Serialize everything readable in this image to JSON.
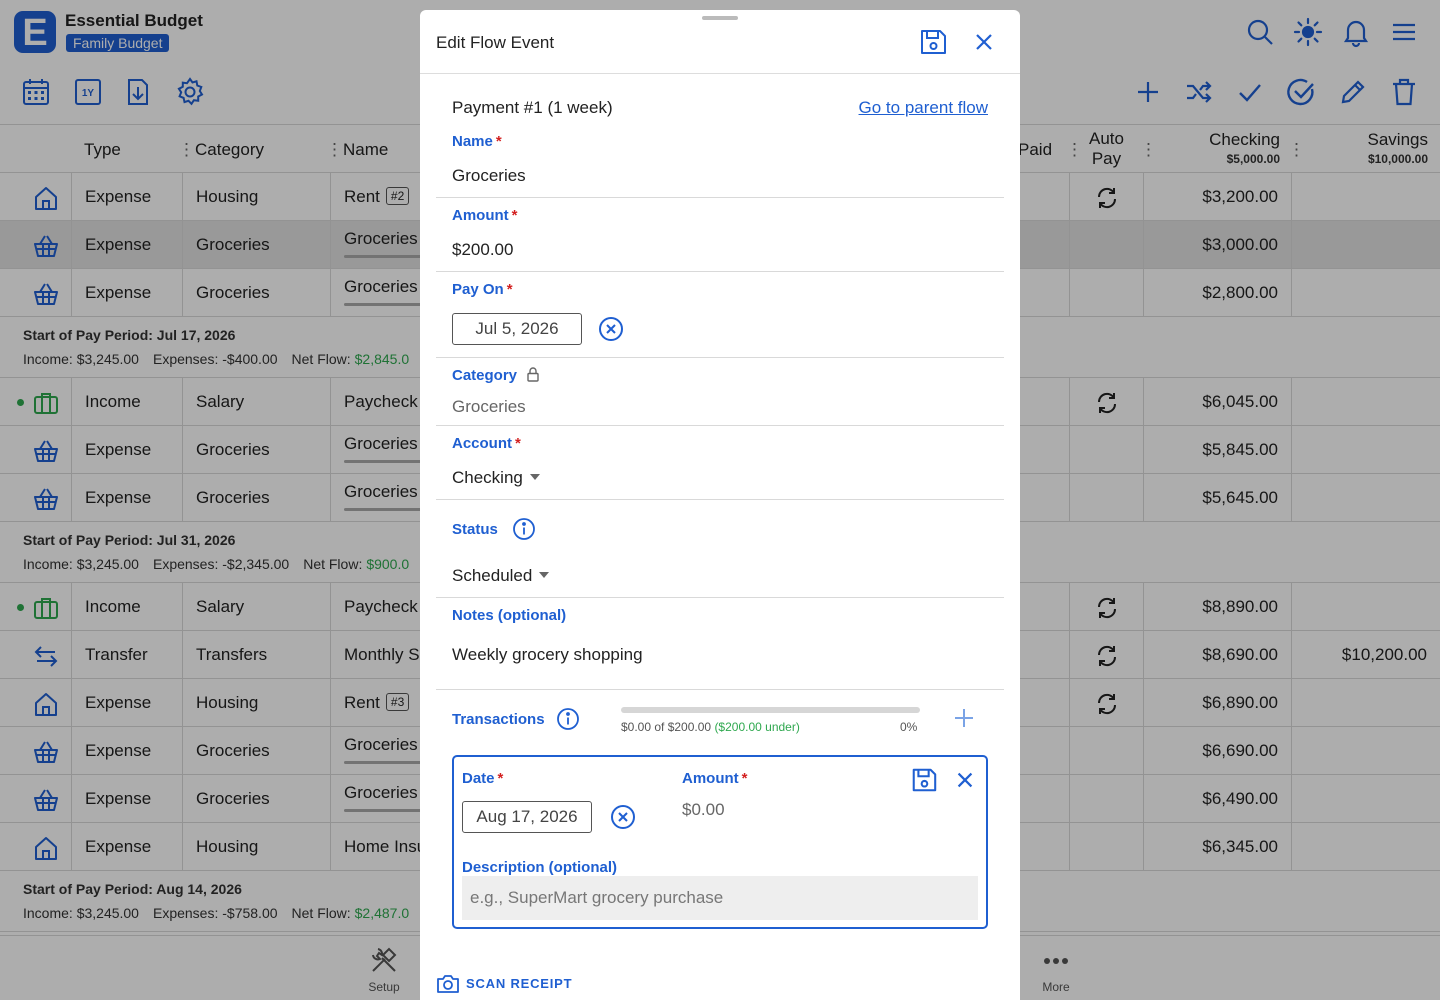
{
  "app": {
    "title": "Essential Budget",
    "badge": "Family Budget",
    "logo_letter": "E"
  },
  "toolbar_left": [
    "calendar-icon",
    "one-year-icon",
    "import-icon",
    "settings-icon"
  ],
  "toolbar_right": [
    "add-icon",
    "shuffle-icon",
    "check-icon",
    "check-circle-icon",
    "edit-icon",
    "delete-icon"
  ],
  "header_icons": [
    "search-icon",
    "theme-icon",
    "bell-icon",
    "menu-icon"
  ],
  "columns": {
    "type": "Type",
    "category": "Category",
    "name": "Name",
    "paid": "Paid",
    "autopay": "Auto",
    "autopay2": "Pay",
    "checking": "Checking",
    "checking_bal": "$5,000.00",
    "savings": "Savings",
    "savings_bal": "$10,000.00"
  },
  "rows": [
    {
      "icon": "house-icon",
      "type": "Expense",
      "category": "Housing",
      "name": "Rent",
      "tag": "#2",
      "autopay": true,
      "checking": "$3,200.00",
      "savings": "",
      "selected": false,
      "income": false,
      "underline": false
    },
    {
      "icon": "basket-icon",
      "type": "Expense",
      "category": "Groceries",
      "name": "Groceries",
      "tag": "",
      "autopay": false,
      "checking": "$3,000.00",
      "savings": "",
      "selected": true,
      "income": false,
      "underline": true
    },
    {
      "icon": "basket-icon",
      "type": "Expense",
      "category": "Groceries",
      "name": "Groceries",
      "tag": "",
      "autopay": false,
      "checking": "$2,800.00",
      "savings": "",
      "selected": false,
      "income": false,
      "underline": true
    },
    {
      "icon": "briefcase-icon",
      "type": "Income",
      "category": "Salary",
      "name": "Paycheck",
      "tag": "",
      "autopay": true,
      "checking": "$6,045.00",
      "savings": "",
      "selected": false,
      "income": true,
      "underline": false
    },
    {
      "icon": "basket-icon",
      "type": "Expense",
      "category": "Groceries",
      "name": "Groceries",
      "tag": "",
      "autopay": false,
      "checking": "$5,845.00",
      "savings": "",
      "selected": false,
      "income": false,
      "underline": true
    },
    {
      "icon": "basket-icon",
      "type": "Expense",
      "category": "Groceries",
      "name": "Groceries",
      "tag": "",
      "autopay": false,
      "checking": "$5,645.00",
      "savings": "",
      "selected": false,
      "income": false,
      "underline": true
    },
    {
      "icon": "briefcase-icon",
      "type": "Income",
      "category": "Salary",
      "name": "Paycheck",
      "tag": "",
      "autopay": true,
      "checking": "$8,890.00",
      "savings": "",
      "selected": false,
      "income": true,
      "underline": false
    },
    {
      "icon": "transfer-icon",
      "type": "Transfer",
      "category": "Transfers",
      "name": "Monthly Sa",
      "tag": "",
      "autopay": true,
      "checking": "$8,690.00",
      "savings": "$10,200.00",
      "selected": false,
      "income": false,
      "underline": false
    },
    {
      "icon": "house-icon",
      "type": "Expense",
      "category": "Housing",
      "name": "Rent",
      "tag": "#3",
      "autopay": true,
      "checking": "$6,890.00",
      "savings": "",
      "selected": false,
      "income": false,
      "underline": false
    },
    {
      "icon": "basket-icon",
      "type": "Expense",
      "category": "Groceries",
      "name": "Groceries",
      "tag": "",
      "autopay": false,
      "checking": "$6,690.00",
      "savings": "",
      "selected": false,
      "income": false,
      "underline": true
    },
    {
      "icon": "basket-icon",
      "type": "Expense",
      "category": "Groceries",
      "name": "Groceries",
      "tag": "",
      "autopay": false,
      "checking": "$6,490.00",
      "savings": "",
      "selected": false,
      "income": false,
      "underline": true
    },
    {
      "icon": "house-icon",
      "type": "Expense",
      "category": "Housing",
      "name": "Home Insu",
      "tag": "",
      "autopay": false,
      "checking": "$6,345.00",
      "savings": "",
      "selected": false,
      "income": false,
      "underline": false
    }
  ],
  "periods": [
    {
      "title": "Start of Pay Period: Jul 17, 2026",
      "income": "Income: $3,245.00",
      "expenses": "Expenses: -$400.00",
      "net_label": "Net Flow:",
      "net": "$2,845.0"
    },
    {
      "title": "Start of Pay Period: Jul 31, 2026",
      "income": "Income: $3,245.00",
      "expenses": "Expenses: -$2,345.00",
      "net_label": "Net Flow:",
      "net": "$900.0"
    },
    {
      "title": "Start of Pay Period: Aug 14, 2026",
      "income": "Income: $3,245.00",
      "expenses": "Expenses: -$758.00",
      "net_label": "Net Flow:",
      "net": "$2,487.0"
    }
  ],
  "bottom_nav": {
    "setup": "Setup",
    "more": "More"
  },
  "modal": {
    "title": "Edit Flow Event",
    "payment_label": "Payment #1 (1 week)",
    "parent_link": "Go to parent flow",
    "name_label": "Name",
    "name_value": "Groceries",
    "amount_label": "Amount",
    "amount_value": "$200.00",
    "payon_label": "Pay On",
    "payon_value": "Jul 5, 2026",
    "category_label": "Category",
    "category_value": "Groceries",
    "account_label": "Account",
    "account_value": "Checking",
    "status_label": "Status",
    "status_value": "Scheduled",
    "notes_label": "Notes (optional)",
    "notes_value": "Weekly grocery shopping",
    "transactions_label": "Transactions",
    "progress": {
      "text": "$0.00 of $200.00",
      "under": "($200.00 under)",
      "percent_text": "0%",
      "fraction": 0.0
    },
    "tx": {
      "date_label": "Date",
      "date_value": "Aug 17, 2026",
      "amount_label": "Amount",
      "amount_value": "$0.00",
      "desc_label": "Description (optional)",
      "desc_placeholder": "e.g., SuperMart grocery purchase"
    },
    "scan_receipt": "SCAN RECEIPT",
    "required_mark": "*"
  },
  "colors": {
    "accent": "#1f5fd1",
    "positive": "#2fa84f",
    "required": "#d32020"
  }
}
